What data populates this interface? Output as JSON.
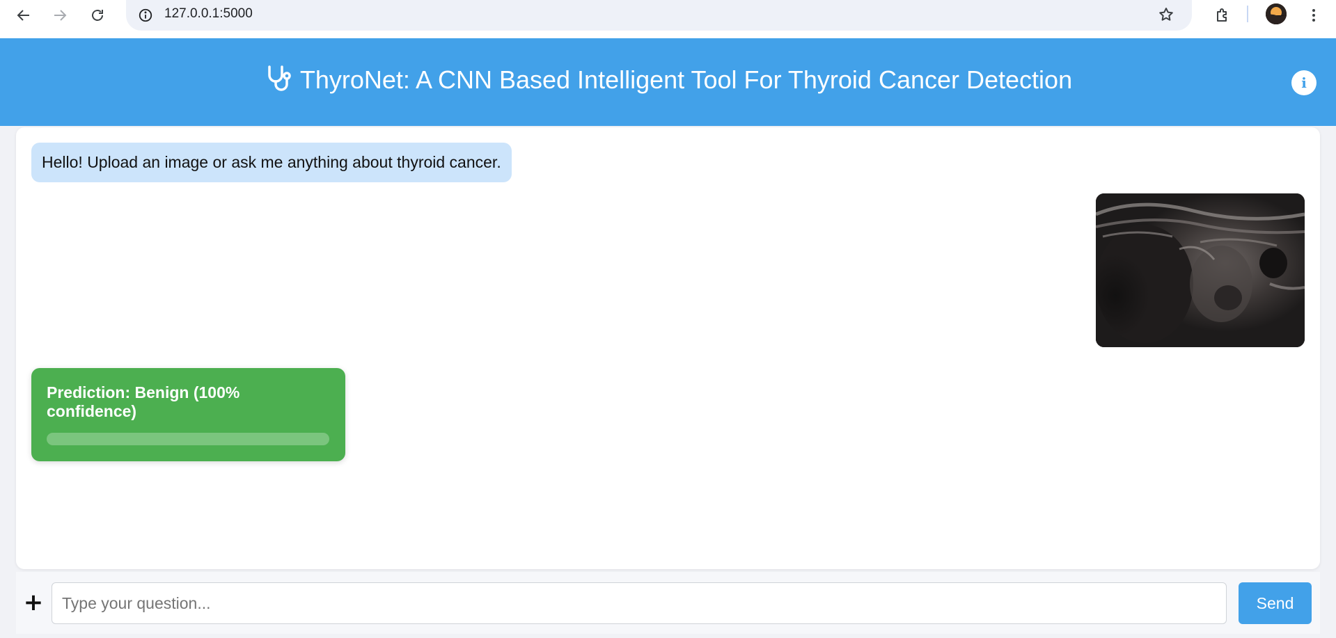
{
  "browser": {
    "url": "127.0.0.1:5000",
    "icons": [
      "back-icon",
      "forward-icon",
      "reload-icon",
      "site-info-icon",
      "bookmark-star-icon",
      "extensions-icon",
      "profile-avatar",
      "menu-dots-icon"
    ]
  },
  "header": {
    "title": "ThyroNet: A CNN Based Intelligent Tool For Thyroid Cancer Detection",
    "icon": "stethoscope-icon",
    "info_label": "i",
    "background_color": "#42a1e9"
  },
  "chat": {
    "bot_greeting": "Hello! Upload an image or ask me anything about thyroid cancer.",
    "user_image": "thyroid-ultrasound-image",
    "prediction": {
      "text": "Prediction: Benign (100% confidence)",
      "confidence": 100,
      "color": "#4caf50"
    }
  },
  "input": {
    "add_label": "+",
    "placeholder": "Type your question...",
    "value": "",
    "send_label": "Send"
  }
}
